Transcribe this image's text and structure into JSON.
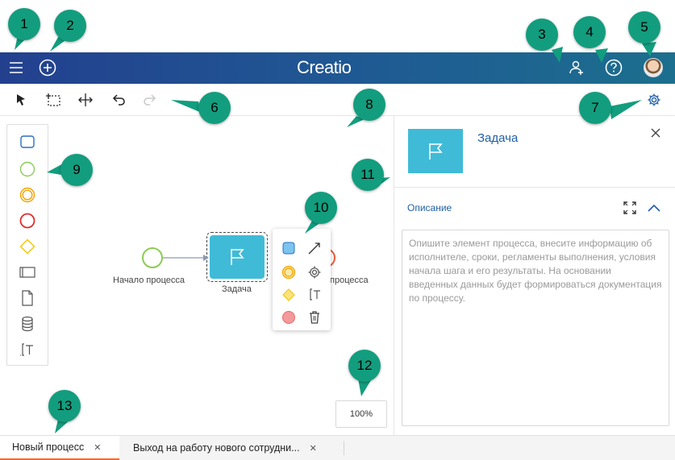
{
  "header": {
    "logo": "Creatio",
    "menu_icon": "hamburger-icon",
    "add_icon": "plus-circle-icon",
    "user_add_icon": "user-plus-icon",
    "help_icon": "question-circle-icon",
    "avatar_icon": "user-avatar-icon",
    "gradient": [
      "#23408f",
      "#1c6f8e"
    ]
  },
  "toolbar": {
    "tools": [
      "pointer-icon",
      "lasso-select-icon",
      "space-tool-icon",
      "undo-icon",
      "redo-icon"
    ],
    "settings_icon": "gear-icon"
  },
  "palette": {
    "items": [
      "task-shape-icon",
      "start-event-icon",
      "intermediate-event-icon",
      "end-event-icon",
      "gateway-icon",
      "subprocess-icon",
      "data-object-icon",
      "data-store-icon",
      "annotation-icon"
    ]
  },
  "diagram": {
    "start_label": "Начало процесса",
    "task_label": "Задача",
    "end_label": "процесса"
  },
  "context_menu": {
    "items": [
      "task-shape-icon",
      "connect-arrow-icon",
      "event-icon",
      "gear-icon",
      "gateway-icon",
      "annotation-icon",
      "end-event-icon",
      "trash-icon"
    ]
  },
  "zoom": {
    "value": "100%"
  },
  "panel": {
    "title": "Задача",
    "section_title": "Описание",
    "description_placeholder": "Опишите элемент процесса, внесите информацию об исполнителе, сроки, регламенты выполнения, условия начала шага и его результаты. На основании введенных данных будет формироваться документация по процессу."
  },
  "tabs": [
    {
      "label": "Новый процесс",
      "active": true
    },
    {
      "label": "Выход на работу нового сотрудни...",
      "active": false
    }
  ],
  "markers": [
    "1",
    "2",
    "3",
    "4",
    "5",
    "6",
    "7",
    "8",
    "9",
    "10",
    "11",
    "12",
    "13"
  ],
  "colors": {
    "accent": "#1f5fa8",
    "task": "#3fbbd7",
    "marker": "#129d7e",
    "tab_active": "#f26b2a"
  }
}
